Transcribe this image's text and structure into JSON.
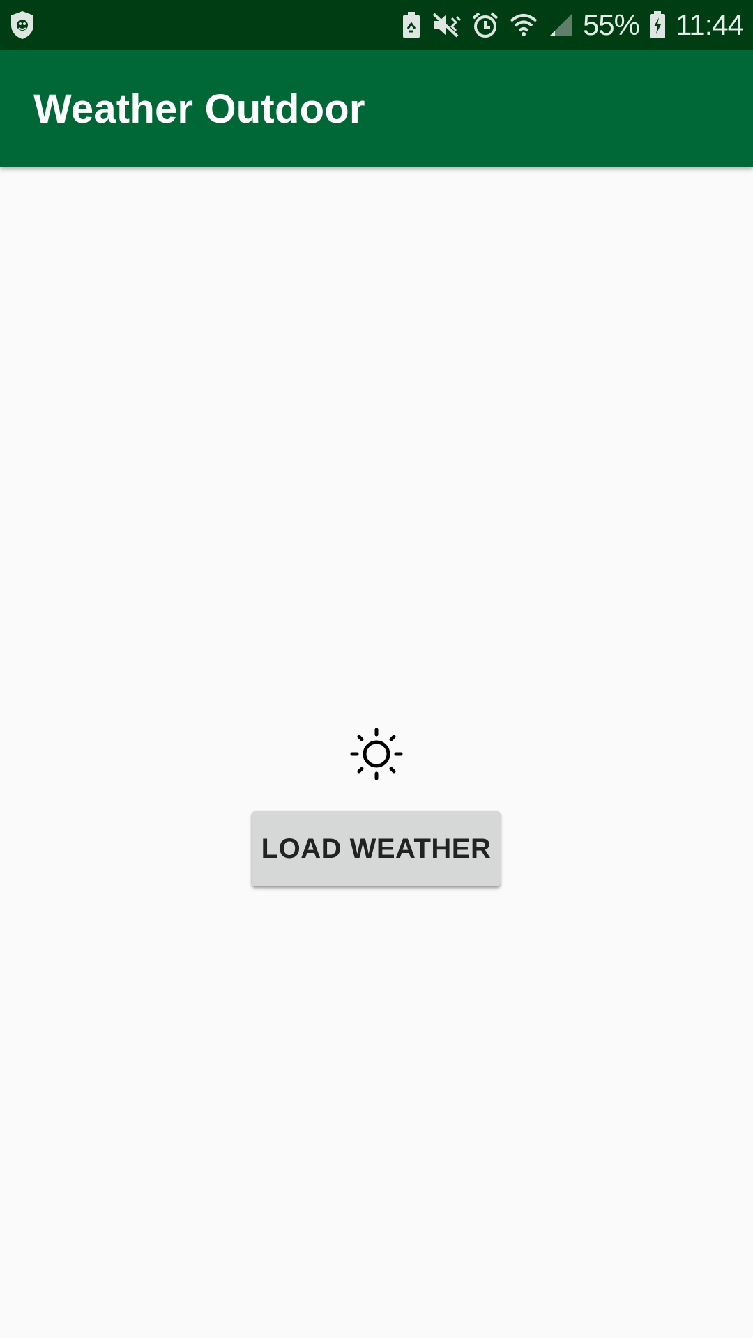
{
  "status_bar": {
    "left_icons": [
      "shield-app-icon"
    ],
    "right_icons": [
      "battery-saver-icon",
      "mute-vibrate-icon",
      "alarm-icon",
      "wifi-icon",
      "signal-icon"
    ],
    "battery_percent": "55%",
    "battery_icon": "battery-charging-icon",
    "time": "11:44"
  },
  "app_bar": {
    "title": "Weather Outdoor",
    "color": "#006837"
  },
  "main": {
    "weather_icon": "sun-icon",
    "load_button_label": "LOAD WEATHER"
  },
  "colors": {
    "status_bar": "#003d12",
    "app_bar": "#006837",
    "background": "#fafafa",
    "button": "#d6d7d7"
  }
}
